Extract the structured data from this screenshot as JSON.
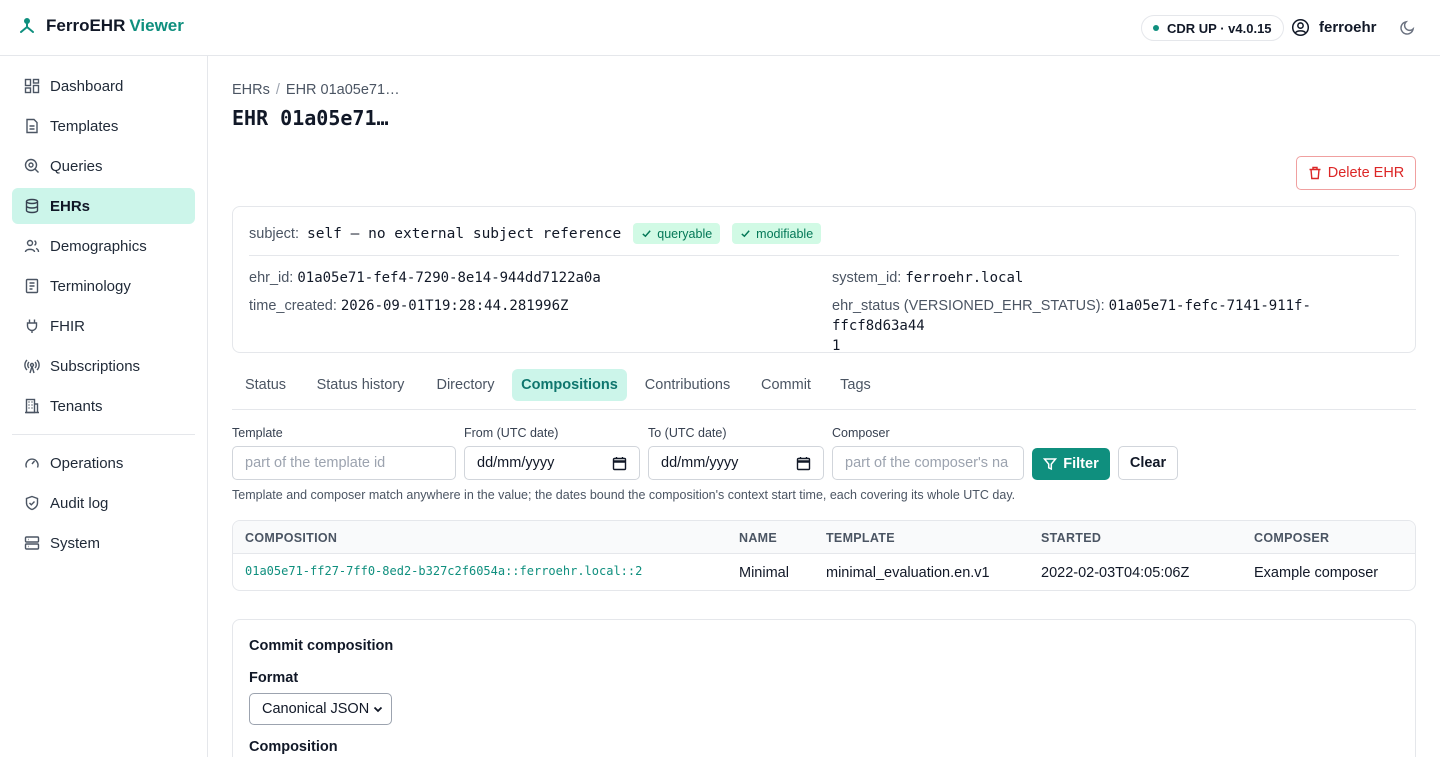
{
  "app": {
    "brand_main": "FerroEHR",
    "brand_accent": "Viewer",
    "status_pill": "CDR UP · v4.0.15",
    "username": "ferroehr"
  },
  "colors": {
    "accent": "#0f8f7e",
    "active_bg": "#ccf5ea",
    "danger": "#dc2626"
  },
  "sidebar": {
    "items": [
      {
        "label": "Dashboard",
        "icon": "dashboard-icon"
      },
      {
        "label": "Templates",
        "icon": "template-icon"
      },
      {
        "label": "Queries",
        "icon": "query-icon"
      },
      {
        "label": "EHRs",
        "icon": "database-icon",
        "active": true
      },
      {
        "label": "Demographics",
        "icon": "users-icon"
      },
      {
        "label": "Terminology",
        "icon": "book-icon"
      },
      {
        "label": "FHIR",
        "icon": "plug-icon"
      },
      {
        "label": "Subscriptions",
        "icon": "broadcast-icon"
      },
      {
        "label": "Tenants",
        "icon": "building-icon"
      },
      {
        "label": "Operations",
        "icon": "gauge-icon"
      },
      {
        "label": "Audit log",
        "icon": "shield-icon"
      },
      {
        "label": "System",
        "icon": "server-icon"
      }
    ]
  },
  "breadcrumb": {
    "root": "EHRs",
    "separator": "/",
    "current": "EHR 01a05e71…"
  },
  "page": {
    "title": "EHR 01a05e71…",
    "delete_label": "Delete EHR"
  },
  "ehr": {
    "subject_label": "subject:",
    "subject_value": "self — no external subject reference",
    "badge_queryable": "queryable",
    "badge_modifiable": "modifiable",
    "ehr_id_label": "ehr_id:",
    "ehr_id": "01a05e71-fef4-7290-8e14-944dd7122a0a",
    "time_created_label": "time_created:",
    "time_created": "2026-09-01T19:28:44.281996Z",
    "system_id_label": "system_id:",
    "system_id": "ferroehr.local",
    "ehr_status_label": "ehr_status (VERSIONED_EHR_STATUS):",
    "ehr_status": "01a05e71-fefc-7141-911f-ffcf8d63a44",
    "ehr_status_wrap": "1"
  },
  "tabs": [
    "Status",
    "Status history",
    "Directory",
    "Compositions",
    "Contributions",
    "Commit",
    "Tags"
  ],
  "active_tab": "Compositions",
  "filters": {
    "template_label": "Template",
    "template_placeholder": "part of the template id",
    "from_label": "From (UTC date)",
    "from_value": "dd/mm/yyyy",
    "to_label": "To (UTC date)",
    "to_value": "dd/mm/yyyy",
    "composer_label": "Composer",
    "composer_placeholder": "part of the composer's na",
    "filter_button": "Filter",
    "clear_button": "Clear",
    "hint": "Template and composer match anywhere in the value; the dates bound the composition's context start time, each covering its whole UTC day."
  },
  "table": {
    "columns": [
      "COMPOSITION",
      "NAME",
      "TEMPLATE",
      "STARTED",
      "COMPOSER"
    ],
    "rows": [
      [
        "01a05e71-ff27-7ff0-8ed2-b327c2f6054a::ferroehr.local::2",
        "Minimal",
        "minimal_evaluation.en.v1",
        "2022-02-03T04:05:06Z",
        "Example composer"
      ]
    ]
  },
  "commit": {
    "title": "Commit composition",
    "format_label": "Format",
    "format_value": "Canonical JSON",
    "composition_label": "Composition"
  }
}
